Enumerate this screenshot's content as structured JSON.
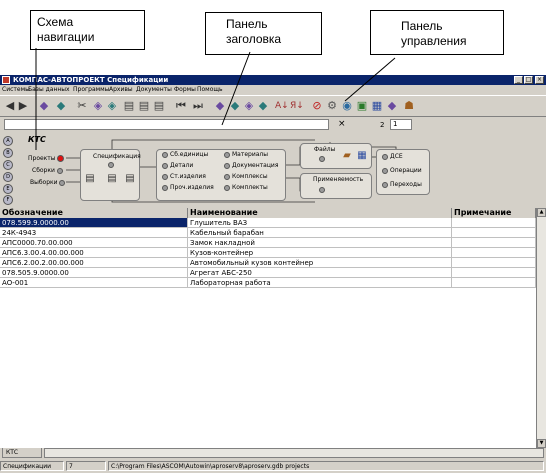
{
  "callouts": {
    "navigation": "Схема\nнавигации",
    "header": "Панель\nзаголовка",
    "control": "Панель\nуправления"
  },
  "window": {
    "title": "КОМПАС-АВТОПРОЕКТ Спецификации",
    "minimize": "_",
    "maximize": "□",
    "close": "×"
  },
  "menu": [
    "Системы",
    "Базы данных",
    "Программы",
    "Архивы",
    "Документы",
    "Формы",
    "Помощь"
  ],
  "toolbar": {
    "icons": [
      "nav-back-icon",
      "nav-forward-icon",
      "stack-icon",
      "stack-2-icon",
      "cut-icon",
      "copy-icon",
      "paste-icon",
      "doc-icon",
      "doc-2-icon",
      "doc-3-icon",
      "first-record-icon",
      "last-record-icon",
      "filter-icon",
      "filter-2-icon",
      "settings-icon",
      "sort-icon",
      "sort-az-icon",
      "sort-za-icon",
      "stop-icon",
      "tools-icon",
      "palette-icon",
      "book-icon",
      "disk-icon",
      "table-icon",
      "diamond-icon",
      "person-icon"
    ]
  },
  "address": {
    "clear": "×",
    "page_label": "2",
    "page_value": "1"
  },
  "navigation": {
    "title": "КТС",
    "side_buttons": [
      "A",
      "B",
      "C",
      "D",
      "E",
      "F"
    ],
    "items_left": [
      "Проекты",
      "Сборки",
      "Выборки"
    ],
    "spec_label": "Спецификация",
    "group1": [
      "Сб.единицы",
      "Детали",
      "Ст.изделия",
      "Проч.изделия"
    ],
    "group2": [
      "Материалы",
      "Документация",
      "Комплексы",
      "Комплекты"
    ],
    "files": "Файлы",
    "usage": "Применяемость",
    "group3": [
      "ДСЕ",
      "Операции",
      "Переходы"
    ]
  },
  "table": {
    "headers": [
      "Обозначение",
      "Наименование",
      "Примечание"
    ],
    "rows": [
      [
        "078.599.9.0000.00",
        "Глушитель ВАЗ",
        ""
      ],
      [
        "24К-4943",
        "Кабельный барабан",
        ""
      ],
      [
        "АПС0000.70.00.000",
        "Замок накладной",
        ""
      ],
      [
        "АПС6.3.00.4.00.00.000",
        "Кузов-контейнер",
        ""
      ],
      [
        "АПС6.2.00.2.00.00.000",
        "Автомобильный кузов контейнер",
        ""
      ],
      [
        "078.505.9.0000.00",
        "Агрегат АБС-250",
        ""
      ],
      [
        "АО-001",
        "Лабораторная работа",
        ""
      ]
    ],
    "selected_row": 0
  },
  "tab": "КТС",
  "status": {
    "mode": "Спецификации",
    "count": "7",
    "path": "C:\\Program Files\\ASCOM\\Autowin\\aproserv8\\aproserv.gdb projects"
  }
}
